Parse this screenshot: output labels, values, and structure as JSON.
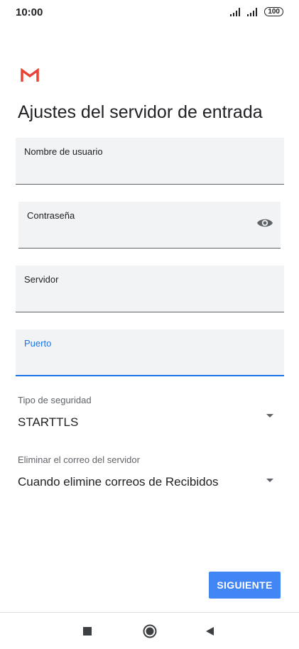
{
  "status_bar": {
    "time": "10:00",
    "battery": "100",
    "icons": [
      "signal-icon",
      "signal-icon",
      "battery-icon"
    ]
  },
  "app": {
    "logo": "gmail-logo",
    "colors": {
      "accent": "#1a73e8",
      "button": "#4285f4",
      "logo_red": "#EA4335"
    }
  },
  "page": {
    "title": "Ajustes del servidor de entrada"
  },
  "fields": {
    "username": {
      "label": "Nombre de usuario",
      "value": ""
    },
    "password": {
      "label": "Contraseña",
      "value": "",
      "icon": "eye-icon"
    },
    "server": {
      "label": "Servidor",
      "value": ""
    },
    "port": {
      "label": "Puerto",
      "value": ""
    }
  },
  "security": {
    "label": "Tipo de seguridad",
    "value": "STARTTLS"
  },
  "delete_mail": {
    "label": "Eliminar el correo del servidor",
    "value": "Cuando elimine correos de Recibidos"
  },
  "actions": {
    "next_label": "SIGUIENTE"
  },
  "nav": {
    "icons": [
      "recent-apps-icon",
      "home-icon",
      "back-icon"
    ]
  }
}
